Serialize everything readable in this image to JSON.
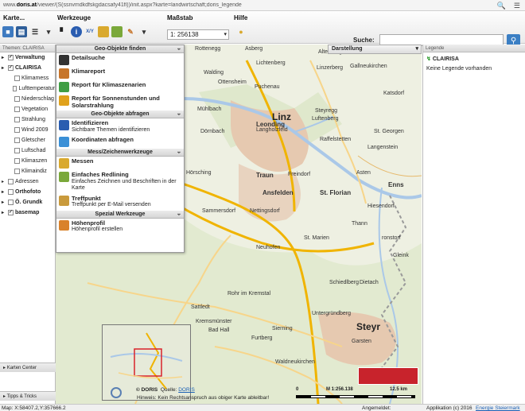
{
  "urlbar": {
    "prefix": "www.",
    "domain": "doris.at",
    "rest": "/viewer/(S(ssnvmdkdfskgdacsafy41fl))/init.aspx?karte=landwirtschaft;doris_legende",
    "search_icon": "search-icon",
    "menu_icon": "menu-icon"
  },
  "toolbar": {
    "karte_label": "Karte...",
    "werkzeuge_label": "Werkzeuge",
    "massstab_label": "Maßstab",
    "hilfe_label": "Hilfe",
    "scale_value": "1: 256138",
    "suche_label": "Suche:",
    "suche_value": ""
  },
  "left_panel": {
    "header": "Themen: CLAIRISA",
    "layers": [
      {
        "label": "Verwaltung",
        "bold": true,
        "checked": true,
        "indent": false
      },
      {
        "label": "CLAIRISA",
        "bold": true,
        "checked": true,
        "indent": false
      },
      {
        "label": "Klimamess",
        "bold": false,
        "checked": false,
        "indent": true
      },
      {
        "label": "Lufttemperatur",
        "bold": false,
        "checked": false,
        "indent": true
      },
      {
        "label": "Niederschlag",
        "bold": false,
        "checked": false,
        "indent": true
      },
      {
        "label": "Vegetation",
        "bold": false,
        "checked": false,
        "indent": true
      },
      {
        "label": "Strahlung",
        "bold": false,
        "checked": false,
        "indent": true
      },
      {
        "label": "Wind 2009",
        "bold": false,
        "checked": false,
        "indent": true
      },
      {
        "label": "Gletscher",
        "bold": false,
        "checked": false,
        "indent": true
      },
      {
        "label": "Luftschad",
        "bold": false,
        "checked": false,
        "indent": true
      },
      {
        "label": "Klimaszen",
        "bold": false,
        "checked": false,
        "indent": true
      },
      {
        "label": "Klimaindiz",
        "bold": false,
        "checked": false,
        "indent": true
      },
      {
        "label": "Adressen",
        "bold": false,
        "checked": false,
        "indent": false
      },
      {
        "label": "Orthofoto",
        "bold": true,
        "checked": false,
        "indent": false
      },
      {
        "label": "Ö. Grundk",
        "bold": true,
        "checked": false,
        "indent": false
      },
      {
        "label": "basemap",
        "bold": true,
        "checked": true,
        "indent": false
      }
    ],
    "karten_center": "Karten Center",
    "tipps": "Tipps & Tricks"
  },
  "darstellung": {
    "label": "Darstellung"
  },
  "dropdown": {
    "sections": [
      {
        "title": "Geo-Objekte finden",
        "items": [
          {
            "label": "Detailsuche",
            "sub": "",
            "icon": "binoculars-icon",
            "color": "#333333"
          },
          {
            "label": "Klimareport",
            "sub": "",
            "icon": "climate-report-icon",
            "color": "#c7752a"
          },
          {
            "label": "Report für Klimaszenarien",
            "sub": "",
            "icon": "scenario-report-icon",
            "color": "#3f9e44"
          },
          {
            "label": "Report für Sonnenstunden und Solarstrahlung",
            "sub": "",
            "icon": "sun-report-icon",
            "color": "#e0a21c"
          }
        ]
      },
      {
        "title": "Geo-Objekte abfragen",
        "items": [
          {
            "label": "Identifizieren",
            "sub": "Sichtbare Themen identifizieren",
            "icon": "info-icon",
            "color": "#2a5db0"
          },
          {
            "label": "Koordinaten abfragen",
            "sub": "",
            "icon": "coordinates-icon",
            "color": "#3a8fd6"
          }
        ]
      },
      {
        "title": "Mess/Zeichenwerkzeuge",
        "items": [
          {
            "label": "Messen",
            "sub": "",
            "icon": "ruler-icon",
            "color": "#d9a92e"
          },
          {
            "label": "Einfaches Redlining",
            "sub": "Einfaches Zeichnen und Beschriften in der Karte",
            "icon": "redlining-icon",
            "color": "#7aa83a"
          },
          {
            "label": "Treffpunkt",
            "sub": "Treffpunkt per E-Mail versenden",
            "icon": "meeting-point-icon",
            "color": "#c99a3c"
          }
        ]
      },
      {
        "title": "Spezial Werkzeuge",
        "items": [
          {
            "label": "Höhenprofil",
            "sub": "Höhenprofil erstellen",
            "icon": "elevation-profile-icon",
            "color": "#d9822b"
          }
        ]
      }
    ]
  },
  "right_panel": {
    "header": "Legende",
    "title": "CLAIRISA",
    "empty_text": "Keine Legende vorhanden"
  },
  "map": {
    "labels": [
      {
        "text": "Rottenegg",
        "cls": ""
      },
      {
        "text": "Asberg",
        "cls": ""
      },
      {
        "text": "Altenberg",
        "cls": ""
      },
      {
        "text": "Lichtenberg",
        "cls": ""
      },
      {
        "text": "Walding",
        "cls": ""
      },
      {
        "text": "Linzerberg",
        "cls": ""
      },
      {
        "text": "Gallneukirchen",
        "cls": ""
      },
      {
        "text": "Ottensheim",
        "cls": ""
      },
      {
        "text": "Puchenau",
        "cls": ""
      },
      {
        "text": "Katsdorf",
        "cls": ""
      },
      {
        "text": "Mühlbach",
        "cls": ""
      },
      {
        "text": "Steyregg",
        "cls": ""
      },
      {
        "text": "Linz",
        "cls": "big"
      },
      {
        "text": "Leonding",
        "cls": "med"
      },
      {
        "text": "Luftenberg",
        "cls": ""
      },
      {
        "text": "St. Georgen",
        "cls": ""
      },
      {
        "text": "Dörnbach",
        "cls": ""
      },
      {
        "text": "Langholzfeld",
        "cls": ""
      },
      {
        "text": "Langenstein",
        "cls": ""
      },
      {
        "text": "Raffelstetten",
        "cls": ""
      },
      {
        "text": "Hörsching",
        "cls": ""
      },
      {
        "text": "Traun",
        "cls": "med"
      },
      {
        "text": "Freindorf",
        "cls": ""
      },
      {
        "text": "Asten",
        "cls": ""
      },
      {
        "text": "Enns",
        "cls": "med"
      },
      {
        "text": "chtrenk",
        "cls": "med"
      },
      {
        "text": "Ansfelden",
        "cls": "med"
      },
      {
        "text": "St. Florian",
        "cls": "med"
      },
      {
        "text": "Sammersdorf",
        "cls": ""
      },
      {
        "text": "Nettingsdorf",
        "cls": ""
      },
      {
        "text": "Hiesendorf",
        "cls": ""
      },
      {
        "text": "Thann",
        "cls": ""
      },
      {
        "text": "St. Marien",
        "cls": ""
      },
      {
        "text": "Neuhofen",
        "cls": ""
      },
      {
        "text": "ronstorf",
        "cls": ""
      },
      {
        "text": "Gleink",
        "cls": ""
      },
      {
        "text": "Schiedlberg",
        "cls": ""
      },
      {
        "text": "Dietach",
        "cls": ""
      },
      {
        "text": "Rohr im Kremstal",
        "cls": ""
      },
      {
        "text": "Sattledt",
        "cls": ""
      },
      {
        "text": "Kremsmünster",
        "cls": ""
      },
      {
        "text": "Untergründberg",
        "cls": ""
      },
      {
        "text": "Bad Hall",
        "cls": ""
      },
      {
        "text": "Sierning",
        "cls": ""
      },
      {
        "text": "Steyr",
        "cls": "big"
      },
      {
        "text": "Furtberg",
        "cls": ""
      },
      {
        "text": "Garsten",
        "cls": ""
      },
      {
        "text": "Waldneukirchen",
        "cls": ""
      }
    ],
    "credit_brand": "© DORIS",
    "credit_source_label": "Quelle:",
    "credit_source_link": "DORIS",
    "hint": "Hinweis: Kein Rechtsanspruch aus obiger Karte ableitbar!",
    "scale_label": "M 1:256.138",
    "scale_km": "12.5 km",
    "scale_zero": "0"
  },
  "footer": {
    "coords": "Map: X:58407.2,Y:357666.2",
    "angemeldet": "Angemeldet:",
    "application": "Applikation (c) 2016",
    "energie_link": "Energie Steiermark"
  },
  "colors": {
    "road_main": "#f0b400",
    "road_secondary": "#f7d58a",
    "river": "#aac8e8",
    "urban": "#e6c9b0",
    "forest": "#cfe2b8",
    "accent_blue": "#3b7fc4",
    "red_logo": "#c8232c"
  }
}
